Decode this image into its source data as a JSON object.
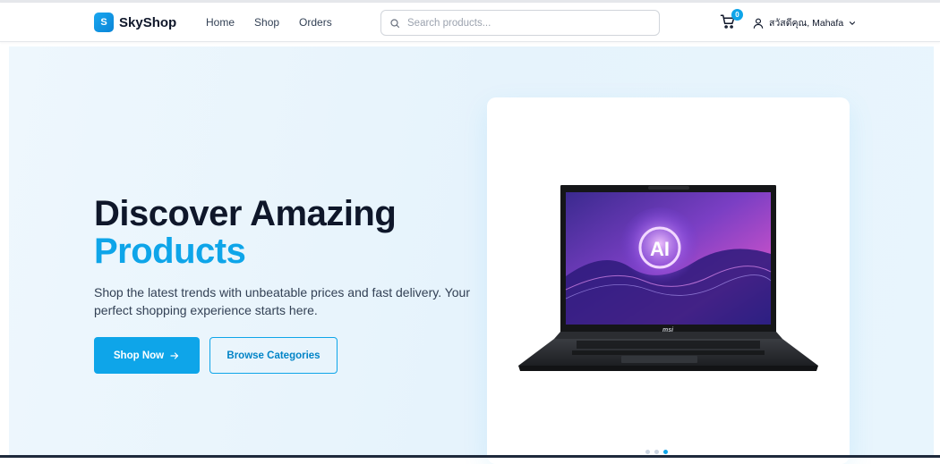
{
  "brand": {
    "logo_letter": "S",
    "name": "SkyShop"
  },
  "nav": {
    "items": [
      {
        "label": "Home"
      },
      {
        "label": "Shop"
      },
      {
        "label": "Orders"
      }
    ]
  },
  "search": {
    "placeholder": "Search products...",
    "value": ""
  },
  "cart": {
    "count": "0"
  },
  "user": {
    "greeting": "สวัสดีคุณ, Mahafa"
  },
  "hero": {
    "title_line1": "Discover Amazing",
    "title_line2": "Products",
    "subtitle": "Shop the latest trends with unbeatable prices and fast delivery. Your perfect shopping experience starts here.",
    "primary_button": "Shop Now",
    "secondary_button": "Browse Categories",
    "product_screen_text": "AI",
    "product_brand": "msi"
  },
  "carousel": {
    "total": 3,
    "active_index": 2
  },
  "colors": {
    "accent": "#0ea5e9",
    "text_dark": "#0f172a",
    "hero_bg": "#e9f5fd"
  },
  "icons": [
    "search-icon",
    "cart-icon",
    "user-icon",
    "chevron-down-icon",
    "arrow-right-icon"
  ]
}
